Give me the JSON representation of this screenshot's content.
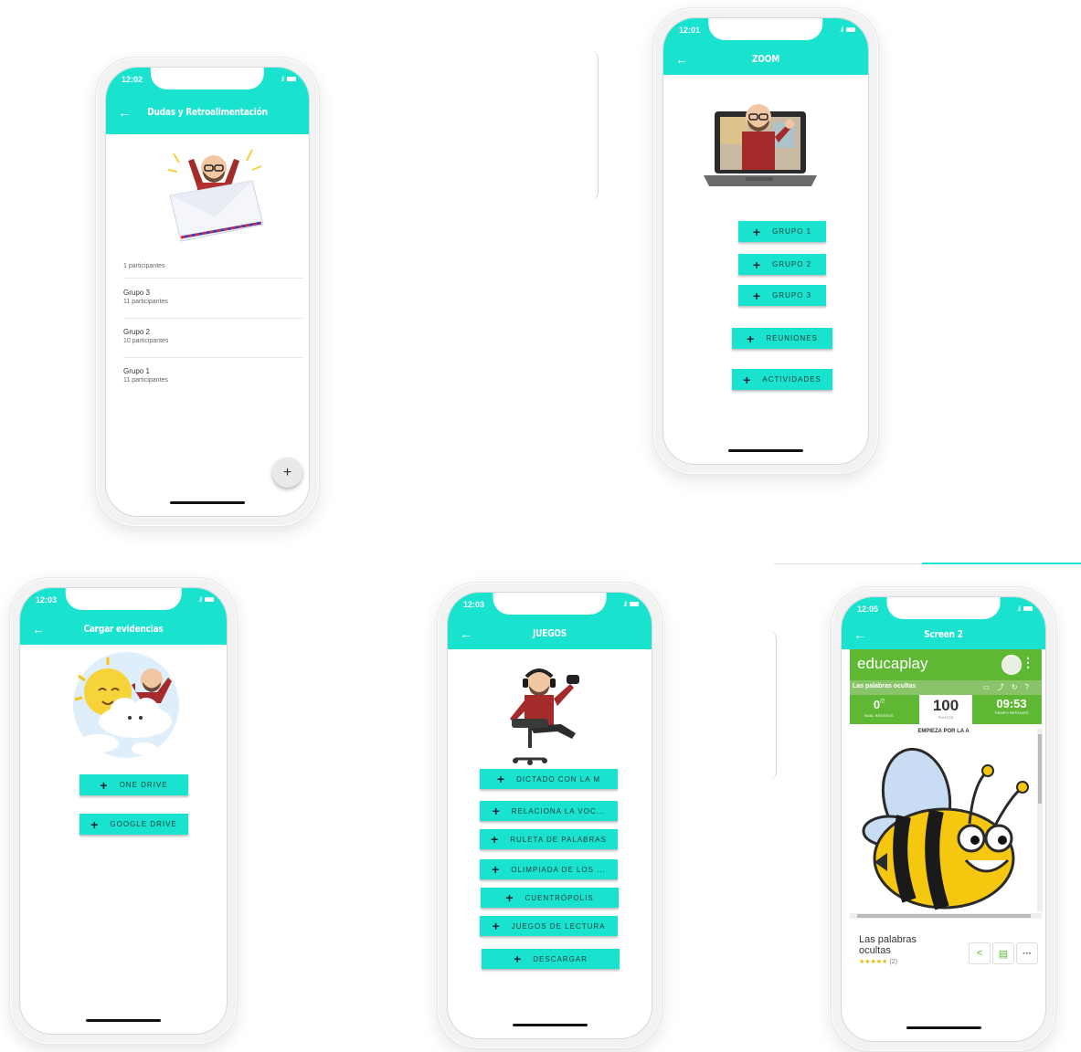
{
  "phones": {
    "dudas": {
      "clock": "12:02",
      "title": "Dudas y Retroalimentación",
      "first_item_sub": "1 participantes",
      "items": [
        {
          "title": "Grupo 3",
          "sub": "11 participantes"
        },
        {
          "title": "Grupo 2",
          "sub": "10 participantes"
        },
        {
          "title": "Grupo 1",
          "sub": "11 participantes"
        }
      ],
      "fab_label": "+"
    },
    "zoom": {
      "clock": "12:01",
      "title": "ZOOM",
      "buttons": [
        "GRUPO 1",
        "GRUPO 2",
        "GRUPO 3",
        "REUNIONES",
        "ACTIVIDADES"
      ]
    },
    "evidencias": {
      "clock": "12:03",
      "title": "Cargar evidencias",
      "buttons": [
        "ONE DRIVE",
        "GOOGLE DRIVE"
      ]
    },
    "juegos": {
      "clock": "12:03",
      "title": "JUEGOS",
      "buttons": [
        "DICTADO CON LA M",
        "RELACIONA LA VOC...",
        "RULETA DE PALABRAS",
        "OLIMPIADA DE LOS ...",
        "CUENTRÓPOLIS",
        "JUEGOS DE LECTURA",
        "DESCARGAR"
      ]
    },
    "screen2": {
      "clock": "12:05",
      "title": "Screen 2",
      "brand": "educaplay",
      "game_title": "Las palabras ocultas",
      "attempts": "0",
      "attempts_sup": "/2",
      "attempts_label": "NUM. INTENTOS",
      "points": "100",
      "points_label": "PUNTOS",
      "time": "09:53",
      "time_label": "TIEMPO RESTANTE",
      "prompt": "EMPIEZA POR LA A",
      "card_title": "Las palabras ocultas",
      "rating_count": "(2)",
      "stars": "★★★★★"
    }
  },
  "icons": {
    "back": "←",
    "plus": "+",
    "share": "share-icon",
    "doc": "document-icon",
    "more": "more-icon"
  },
  "colors": {
    "accent": "#19e3cf",
    "educaplay_green": "#5fb833"
  }
}
